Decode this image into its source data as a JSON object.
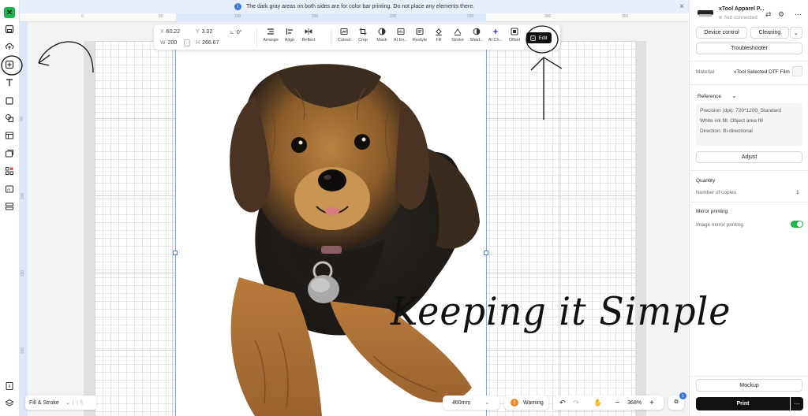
{
  "banner": {
    "text": "The dark gray areas on both sides are for color bar printing. Do not place any elements there.",
    "close": "×"
  },
  "ruler": {
    "top_ticks": [
      "0",
      "50",
      "100",
      "150",
      "200",
      "250",
      "300",
      "350"
    ],
    "left_ticks": [
      "50",
      "100",
      "150",
      "200"
    ]
  },
  "props": {
    "x_label": "X",
    "x_value": "60.22",
    "y_label": "Y",
    "y_value": "3.02",
    "w_label": "W",
    "w_value": "200",
    "h_label": "H",
    "h_value": "266.67",
    "rotation": "0°",
    "tools": [
      {
        "label": "Arrange",
        "icon": "arrange-icon"
      },
      {
        "label": "Align",
        "icon": "align-icon"
      },
      {
        "label": "Reflect",
        "icon": "reflect-icon"
      },
      {
        "label": "Cutout",
        "icon": "cutout-icon"
      },
      {
        "label": "Crop",
        "icon": "crop-icon"
      },
      {
        "label": "Mask",
        "icon": "mask-icon"
      },
      {
        "label": "AI En...",
        "icon": "ai-enhance-icon"
      },
      {
        "label": "Restyle",
        "icon": "restyle-icon"
      },
      {
        "label": "Fill",
        "icon": "fill-icon"
      },
      {
        "label": "Stroke",
        "icon": "stroke-icon"
      },
      {
        "label": "Shad...",
        "icon": "shadow-icon"
      },
      {
        "label": "AI Ch...",
        "icon": "ai-change-icon"
      },
      {
        "label": "Offset",
        "icon": "offset-icon"
      }
    ],
    "edit_label": "Edit"
  },
  "bottom": {
    "fill_stroke": "Fill & Stroke",
    "size": "460mm",
    "warning": "Warning",
    "zoom": "368%",
    "layer_badge": "1"
  },
  "annotation": {
    "text": "Keeping it Simple"
  },
  "right_panel": {
    "printer_name": "xTool Apparel P...",
    "status": "Not connected",
    "device_control": "Device control",
    "cleaning": "Cleaning",
    "troubleshooter": "Troubleshooter",
    "material_label": "Material",
    "material_value": "xTool Selected DTF Film",
    "reference_label": "Reference",
    "precision": "Precision (dpi): 720*1200_Standard",
    "white_ink": "White ink fill: Object area fill",
    "direction": "Direction: Bi-directional",
    "adjust": "Adjust",
    "quantity_title": "Quantity",
    "copies_label": "Number of copies",
    "copies_value": "1",
    "mirror_title": "Mirror printing",
    "mirror_label": "Image mirror printing",
    "mirror_on": true,
    "mockup": "Mockup",
    "print": "Print",
    "more": "···"
  },
  "colors": {
    "accent": "#1fb44b",
    "banner_bg": "#e8eefb",
    "info": "#3b74e8",
    "warning": "#f08a24",
    "dark_button": "#111111"
  }
}
